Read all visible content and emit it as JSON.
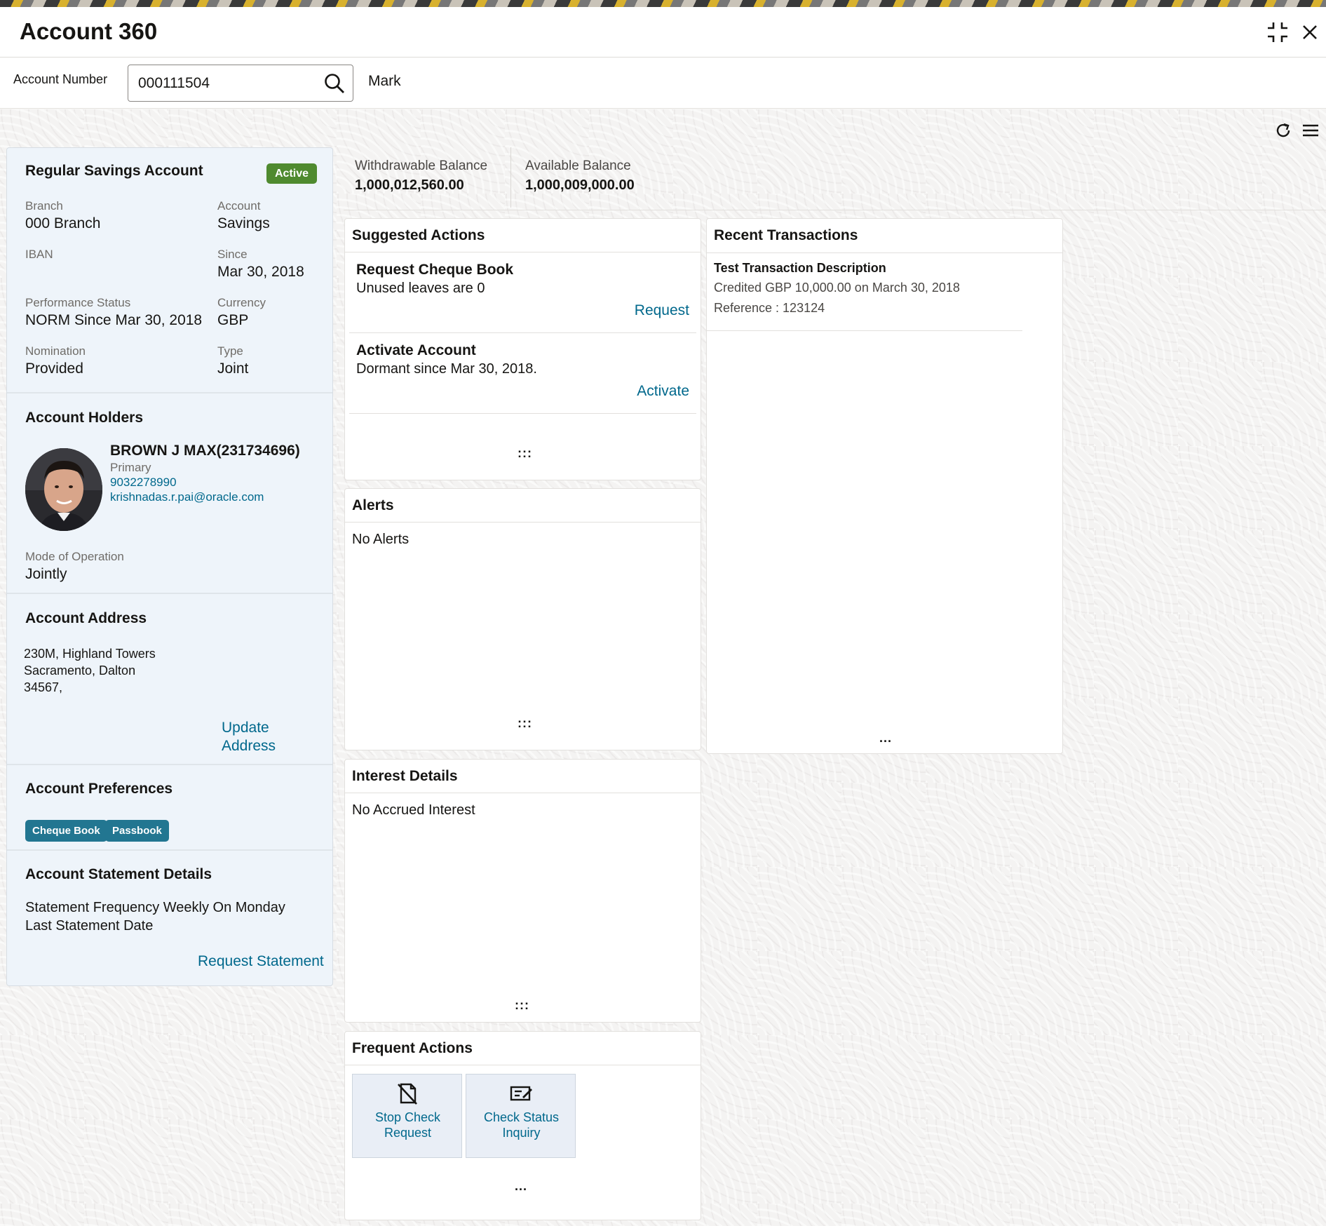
{
  "window": {
    "title": "Account 360",
    "minimize_icon": "collapse-icon",
    "close_icon": "close-icon"
  },
  "search": {
    "label": "Account Number",
    "value": "000111504",
    "customer_name": "Mark"
  },
  "toolbar": {
    "refresh_icon": "refresh-icon",
    "menu_icon": "hamburger-menu-icon"
  },
  "account": {
    "name": "Regular Savings Account",
    "status": "Active",
    "fields": [
      {
        "label": "Branch",
        "value": "000 Branch"
      },
      {
        "label": "Account",
        "value": "Savings"
      },
      {
        "label": "IBAN",
        "value": ""
      },
      {
        "label": "Since",
        "value": "Mar 30, 2018"
      },
      {
        "label": "Performance Status",
        "value": "NORM Since Mar 30, 2018"
      },
      {
        "label": "Currency",
        "value": "GBP"
      },
      {
        "label": "Nomination",
        "value": "Provided"
      },
      {
        "label": "Type",
        "value": "Joint"
      }
    ]
  },
  "holders": {
    "title": "Account Holders",
    "name": "BROWN J MAX(231734696)",
    "role": "Primary",
    "phone": "9032278990",
    "email": "krishnadas.r.pai@oracle.com",
    "mode_label": "Mode of Operation",
    "mode_value": "Jointly"
  },
  "address": {
    "title": "Account Address",
    "lines": [
      "230M, Highland Towers",
      "Sacramento, Dalton",
      "34567,"
    ],
    "update_link_line1": "Update",
    "update_link_line2": "Address"
  },
  "preferences": {
    "title": "Account Preferences",
    "chips": [
      "Cheque Book",
      "Passbook"
    ]
  },
  "statement": {
    "title": "Account Statement Details",
    "frequency": "Statement Frequency Weekly On Monday",
    "last_date": "Last Statement Date",
    "request_link": "Request Statement"
  },
  "balances": [
    {
      "label": "Withdrawable Balance",
      "value": "1,000,012,560.00"
    },
    {
      "label": "Available Balance",
      "value": "1,000,009,000.00"
    }
  ],
  "suggested_actions": {
    "title": "Suggested Actions",
    "items": [
      {
        "title": "Request Cheque Book",
        "desc": "Unused leaves are 0",
        "action": "Request"
      },
      {
        "title": "Activate Account",
        "desc": "Dormant since Mar 30, 2018.",
        "action": "Activate"
      }
    ],
    "drag_handle": ":::"
  },
  "alerts": {
    "title": "Alerts",
    "empty_text": "No Alerts",
    "drag_handle": ":::"
  },
  "interest": {
    "title": "Interest Details",
    "empty_text": "No Accrued Interest",
    "drag_handle": ":::"
  },
  "frequent_actions": {
    "title": "Frequent Actions",
    "tiles": [
      {
        "line1": "Stop Check",
        "line2": "Request",
        "icon": "stop-cheque-icon"
      },
      {
        "line1": "Check Status",
        "line2": "Inquiry",
        "icon": "cheque-status-icon"
      }
    ],
    "more": "..."
  },
  "recent_transactions": {
    "title": "Recent Transactions",
    "items": [
      {
        "description": "Test Transaction Description",
        "detail": "Credited GBP 10,000.00 on March 30, 2018",
        "reference": "Reference : 123124"
      }
    ],
    "more": "..."
  },
  "colors": {
    "accent_link": "#00688c",
    "status_active": "#4f8a2f",
    "chip": "#227691",
    "left_panel_bg": "#eef4fa"
  }
}
